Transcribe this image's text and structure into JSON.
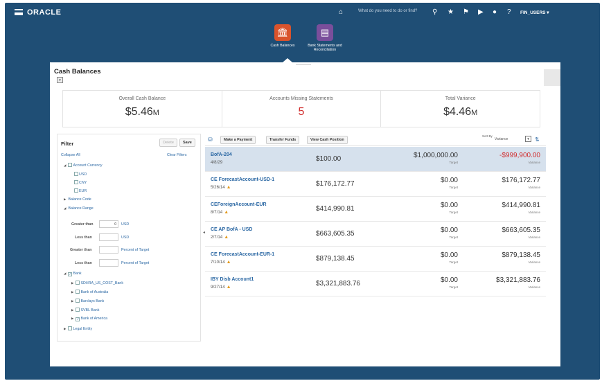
{
  "header": {
    "logo": "ORACLE",
    "search_placeholder": "What do you need to do or find?",
    "user": "FIN_USERS ▾"
  },
  "springboard": [
    {
      "label": "Cash Balances",
      "color": "#d9532c",
      "icon": "bank-icon"
    },
    {
      "label": "Bank Statements and Reconciliation",
      "color": "#7a4e9b",
      "icon": "statement-icon"
    }
  ],
  "page": {
    "title": "Cash Balances"
  },
  "summary": [
    {
      "label": "Overall Cash Balance",
      "value": "$5.46",
      "unit": "M"
    },
    {
      "label": "Accounts Missing Statements",
      "value": "5",
      "unit": ""
    },
    {
      "label": "Total Variance",
      "value": "$4.46",
      "unit": "M"
    }
  ],
  "filter": {
    "title": "Filter",
    "delete": "Delete",
    "save": "Save",
    "collapse_all": "Collapse All",
    "clear_filters": "Clear Filters",
    "account_currency": "Account Currency",
    "currencies": [
      "USD",
      "CNY",
      "EUR"
    ],
    "balance_code": "Balance Code",
    "balance_range": "Balance Range",
    "greater_than": "Greater than",
    "less_than": "Less than",
    "usd": "USD",
    "gt_value": "0",
    "percent_of_target": "Percent of Target",
    "bank": "Bank",
    "banks": [
      "SDHRA_US_COST_Bank",
      "Bank of Australia",
      "Barclays Bank",
      "SVBL Bank",
      "Bank of America"
    ],
    "legal_entity": "Legal Entity"
  },
  "toolbar": {
    "make_payment": "Make a Payment",
    "transfer_funds": "Transfer Funds",
    "view_cash_position": "View Cash Position",
    "sort_by": "Sort By",
    "sort_value": "Variance"
  },
  "rows": [
    {
      "name": "BofA-204",
      "date": "4/8/29",
      "warn": false,
      "amount": "$100.00",
      "target": "$1,000,000.00",
      "target_label": "Target",
      "variance": "-$999,900.00",
      "variance_label": "Variance",
      "neg": true
    },
    {
      "name": "CE ForecastAccount-USD-1",
      "date": "5/26/14",
      "warn": true,
      "amount": "$176,172.77",
      "target": "$0.00",
      "target_label": "Target",
      "variance": "$176,172.77",
      "variance_label": "Variance",
      "neg": false
    },
    {
      "name": "CEForeignAccount-EUR",
      "date": "8/7/14",
      "warn": true,
      "amount": "$414,990.81",
      "target": "$0.00",
      "target_label": "Target",
      "variance": "$414,990.81",
      "variance_label": "Variance",
      "neg": false
    },
    {
      "name": "CE AP BofA - USD",
      "date": "2/7/14",
      "warn": true,
      "amount": "$663,605.35",
      "target": "$0.00",
      "target_label": "Target",
      "variance": "$663,605.35",
      "variance_label": "Variance",
      "neg": false
    },
    {
      "name": "CE ForecastAccount-EUR-1",
      "date": "7/10/14",
      "warn": true,
      "amount": "$879,138.45",
      "target": "$0.00",
      "target_label": "Target",
      "variance": "$879,138.45",
      "variance_label": "Variance",
      "neg": false
    },
    {
      "name": "IBY Disb Account1",
      "date": "9/27/14",
      "warn": true,
      "amount": "$3,321,883.76",
      "target": "$0.00",
      "target_label": "Target",
      "variance": "$3,321,883.76",
      "variance_label": "Variance",
      "neg": false
    }
  ]
}
